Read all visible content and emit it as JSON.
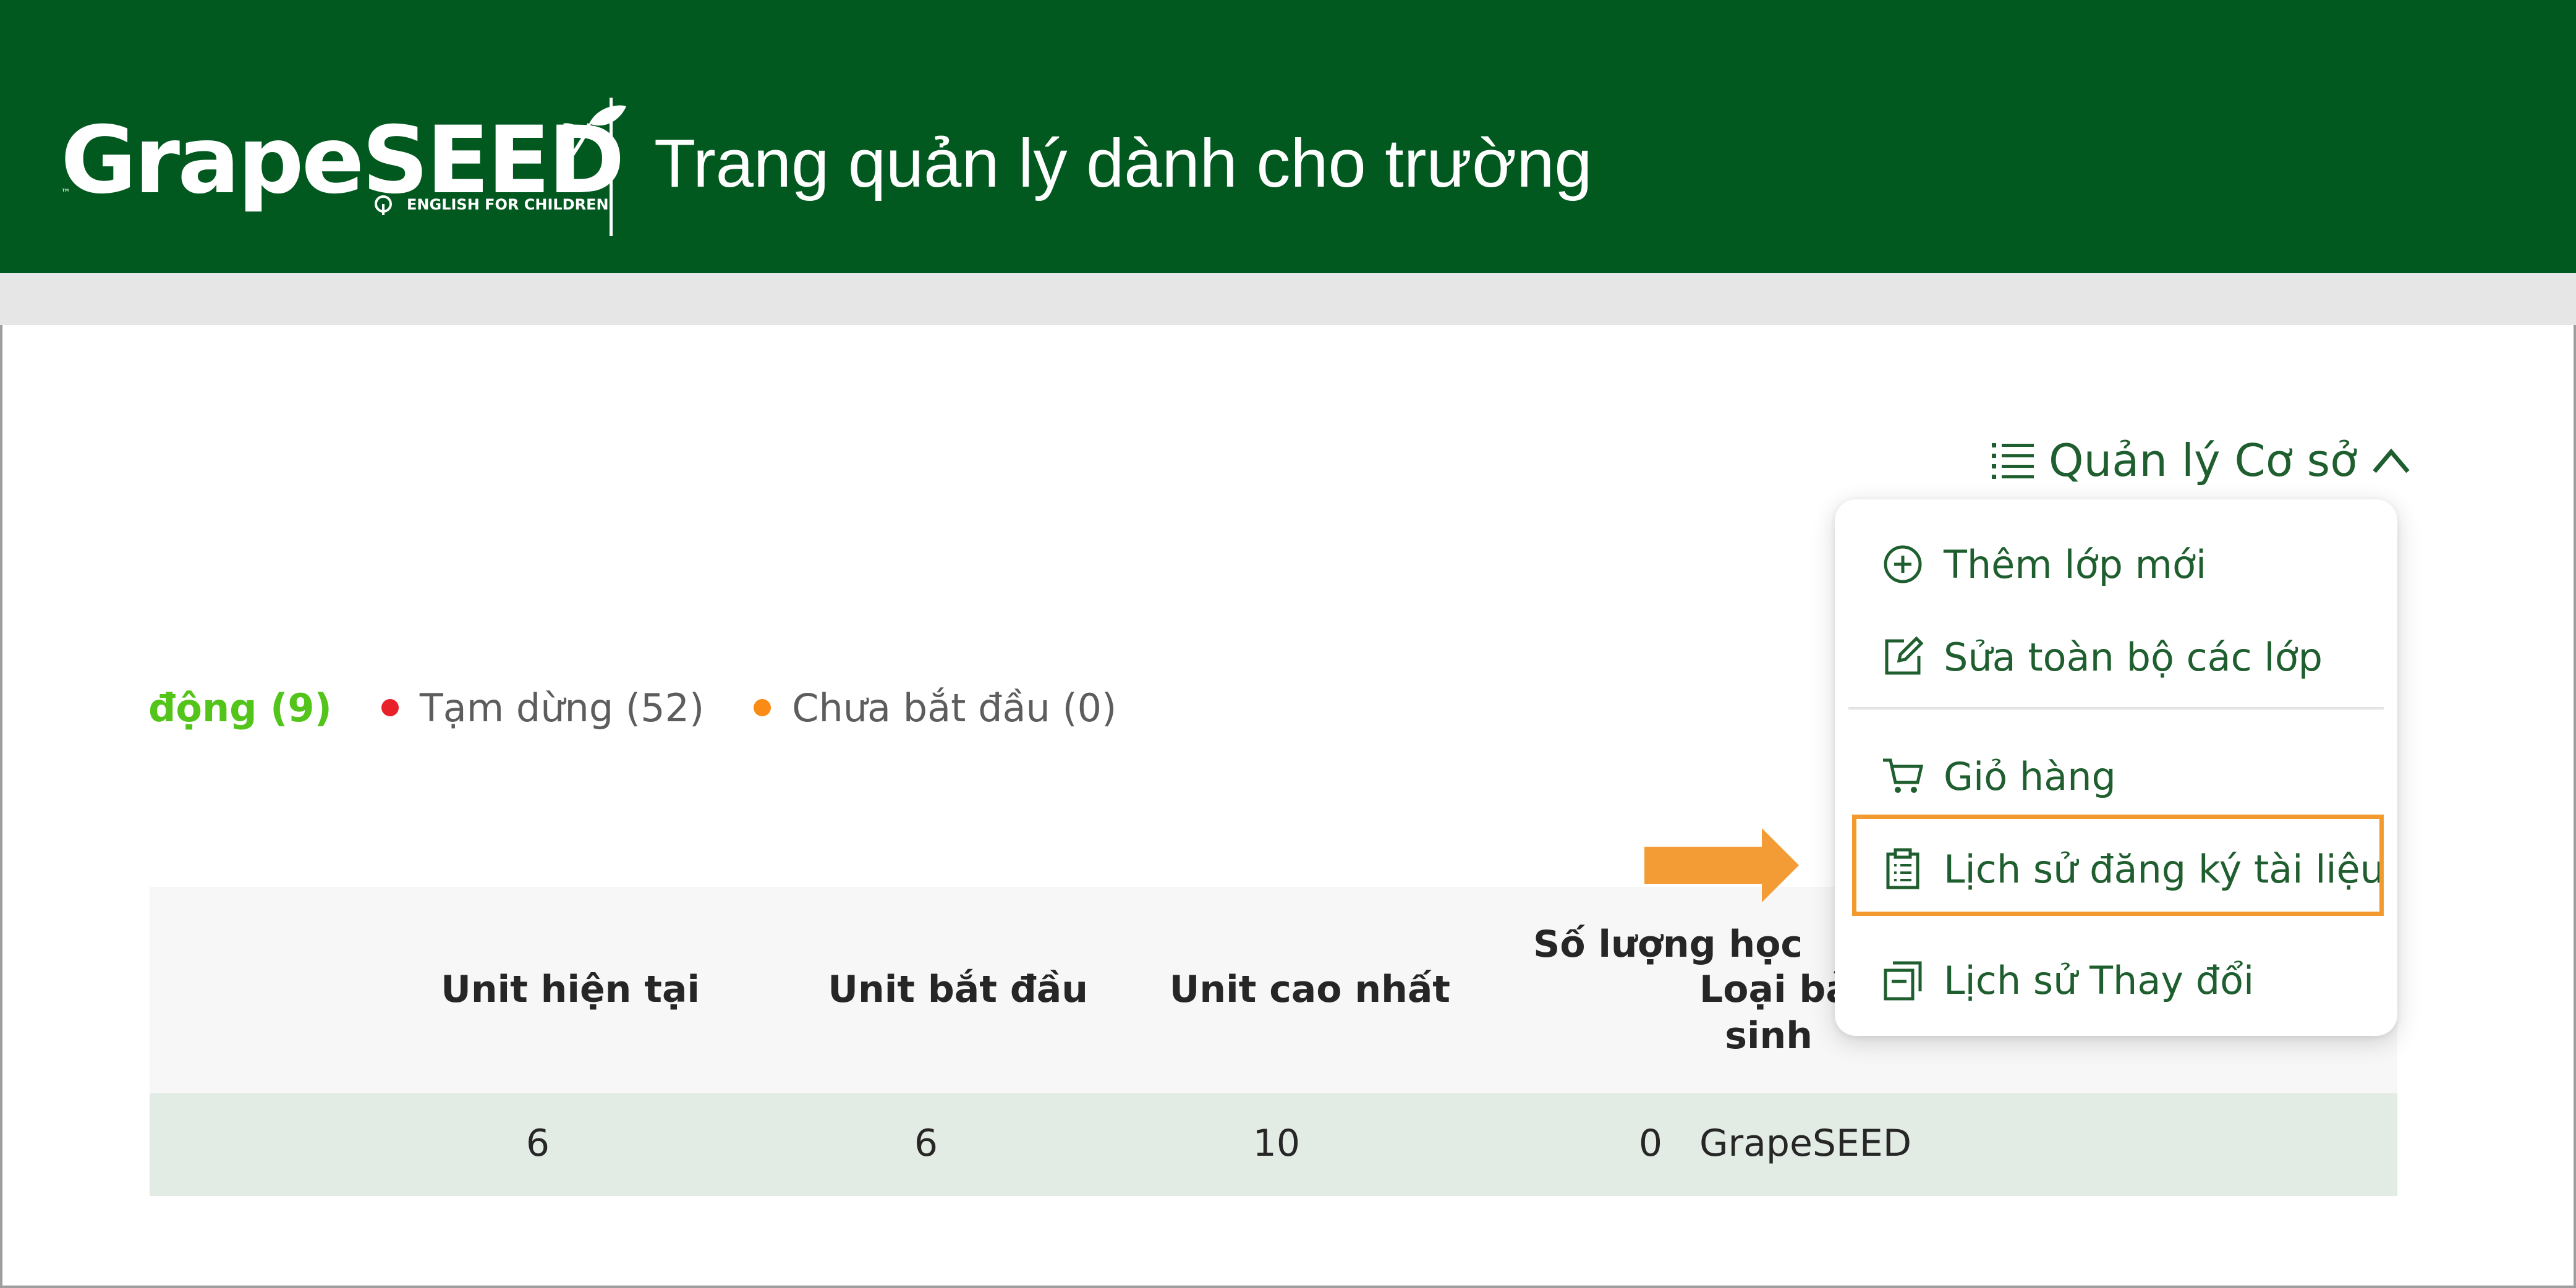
{
  "header": {
    "logo_text": "GrapeSEED",
    "logo_tagline": "ENGLISH FOR CHILDREN",
    "title": "Trang quản lý dành cho trường"
  },
  "manage_menu": {
    "label": "Quản lý Cơ sở",
    "items": [
      {
        "label": "Thêm lớp mới",
        "icon": "plus-circle-icon"
      },
      {
        "label": "Sửa toàn bộ các lớp",
        "icon": "edit-icon"
      },
      {
        "label": "Giỏ hàng",
        "icon": "cart-icon"
      },
      {
        "label": "Lịch sử đăng ký tài liệu",
        "icon": "clipboard-icon"
      },
      {
        "label": "Lịch sử Thay đổi",
        "icon": "history-icon"
      }
    ]
  },
  "status_filters": {
    "active": "động (9)",
    "paused": "Tạm dừng (52)",
    "not_started": "Chưa bắt đầu (0)"
  },
  "colors": {
    "brand": "#02591f",
    "active": "#52c41a",
    "paused": "#e8202a",
    "not_started": "#fa8c16",
    "highlight": "#f29a2e"
  },
  "table": {
    "headers": {
      "current_unit": "Unit hiện tại",
      "start_unit": "Unit bắt đầu",
      "max_unit": "Unit cao nhất",
      "students_line1": "Số lượng học",
      "students_line2": "sinh",
      "type": "Loại bả"
    },
    "rows": [
      {
        "current_unit": "6",
        "start_unit": "6",
        "max_unit": "10",
        "students": "0",
        "type": "GrapeSEED"
      }
    ]
  }
}
